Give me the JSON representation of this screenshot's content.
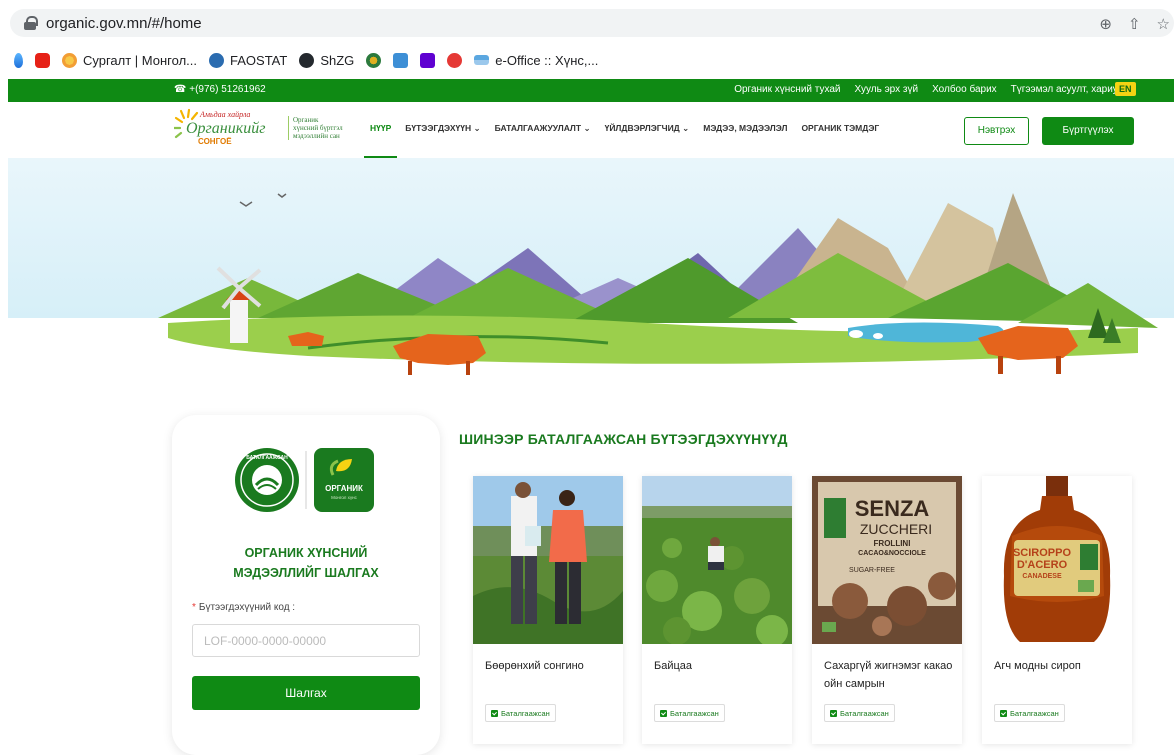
{
  "browser": {
    "url": "organic.gov.mn/#/home",
    "bookmarks": [
      {
        "label": "",
        "icon": "drop-icon"
      },
      {
        "label": "",
        "icon": "youtube-icon"
      },
      {
        "label": "Сургалт | Монгол...",
        "icon": "site-icon"
      },
      {
        "label": "FAOSTAT",
        "icon": "fao-icon"
      },
      {
        "label": "ShZG",
        "icon": "github-icon"
      },
      {
        "label": "",
        "icon": "emblem-icon"
      },
      {
        "label": "",
        "icon": "mail-icon"
      },
      {
        "label": "",
        "icon": "yahoo-icon"
      },
      {
        "label": "",
        "icon": "app-icon"
      },
      {
        "label": "e-Office :: Хүнс,...",
        "icon": "office-icon"
      }
    ]
  },
  "topbar": {
    "phone": "+(976) 51261962",
    "links": [
      "Органик хүнсний тухай",
      "Хууль эрх зүй",
      "Холбоо барих",
      "Түгээмэл асуулт, хариулт"
    ],
    "lang": "EN"
  },
  "header": {
    "logo_text_top": "Амьдаа хайрла",
    "logo_text_main": "Органикийг",
    "logo_text_bottom": "СОНГОЁ",
    "logo_caption": [
      "Органик",
      "хүнсний бүртгэл",
      "мэдээллийн сан"
    ],
    "nav": [
      "НҮҮР",
      "БҮТЭЭГДЭХҮҮН",
      "БАТАЛГААЖУУЛАЛТ",
      "ҮЙЛДВЭРЛЭГЧИД",
      "МЭДЭЭ, МЭДЭЭЛЭЛ",
      "ОРГАНИК ТЭМДЭГ"
    ],
    "login": "Нэвтрэх",
    "register": "Бүртгүүлэх"
  },
  "search": {
    "badge_certified": "БАТАЛГААЖСАН",
    "badge_organic": "ОРГАНИК",
    "badge_organic_sub": "Монгол хүнс",
    "title_line1": "ОРГАНИК ХҮНСНИЙ",
    "title_line2": "МЭДЭЭЛЛИЙГ ШАЛГАХ",
    "required_mark": "*",
    "field_label": "Бүтээгдэхүүний код :",
    "placeholder": "LOF-0000-0000-00000",
    "button": "Шалгах"
  },
  "products": {
    "section_title": "ШИНЭЭР БАТАЛГААЖСАН БҮТЭЭГДЭХҮҮНҮҮД",
    "items": [
      {
        "name": "Бөөрөнхий сонгино",
        "status": "Баталгаажсан"
      },
      {
        "name": "Байцаа",
        "status": "Баталгаажсан"
      },
      {
        "name": "Сахаргүй жигнэмэг какао ойн самрын",
        "status": "Баталгаажсан",
        "package_text": [
          "SENZA",
          "ZUCCHERI",
          "FROLLINI",
          "CACAO&NOCCIOLE",
          "SUGAR-FREE"
        ]
      },
      {
        "name": "Агч модны сироп",
        "status": "Баталгаажсан",
        "package_text": [
          "SCIROPPO",
          "D'ACERO",
          "CANADESE"
        ]
      }
    ]
  },
  "colors": {
    "brand_green": "#0f8a14",
    "accent_yellow": "#f4d313"
  }
}
